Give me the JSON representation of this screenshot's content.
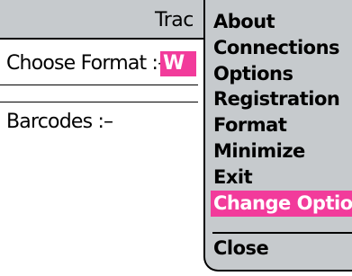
{
  "window": {
    "title": "Trac"
  },
  "form": {
    "format_label": "Choose Format :–",
    "format_value": "W",
    "barcodes_label": "Barcodes :–"
  },
  "menu": {
    "items": [
      {
        "label": "About"
      },
      {
        "label": "Connections"
      },
      {
        "label": "Options"
      },
      {
        "label": "Registration"
      },
      {
        "label": "Format"
      },
      {
        "label": "Minimize"
      },
      {
        "label": "Exit"
      },
      {
        "label": "Change Option"
      },
      {
        "label": "Close"
      }
    ],
    "active_item": "Change Option"
  },
  "colors": {
    "highlight": "#f23b9b",
    "menu_bg": "#c6cacd"
  }
}
